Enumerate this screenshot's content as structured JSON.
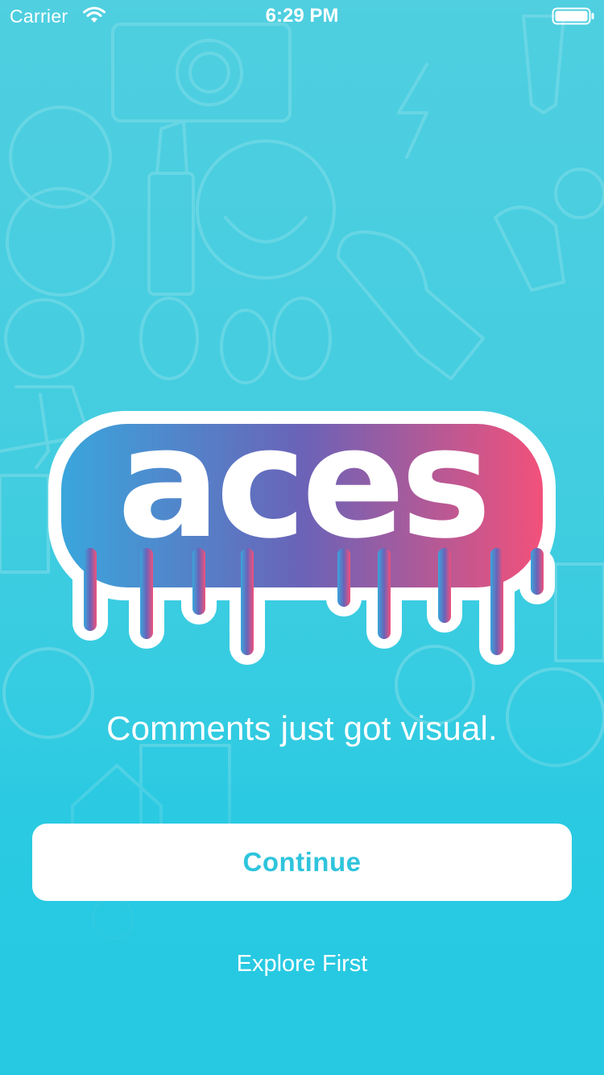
{
  "status_bar": {
    "carrier": "Carrier",
    "time": "6:29 PM",
    "wifi_icon": "wifi-icon",
    "battery_icon": "battery-full-icon"
  },
  "logo": {
    "wordmark": "aces",
    "gradient_start": "#3aa6dc",
    "gradient_end": "#f2517a"
  },
  "tagline": "Comments just got visual.",
  "continue_button": {
    "label": "Continue",
    "text_color": "#2fc4dc"
  },
  "explore_link": "Explore First",
  "colors": {
    "background": "#3ccde0",
    "accent": "#2fc4dc"
  }
}
